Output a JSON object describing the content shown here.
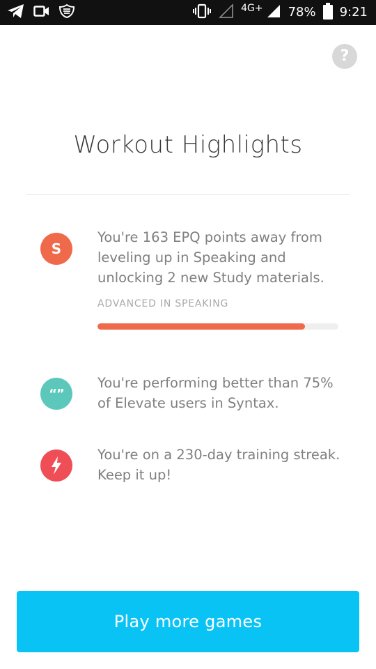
{
  "status_bar": {
    "network": "4G+",
    "battery": "78%",
    "time": "9:21",
    "icons": [
      "telegram-icon",
      "video-camera-icon",
      "app-shield-icon",
      "vibrate-icon",
      "signal-empty-icon",
      "signal-full-icon",
      "battery-icon"
    ]
  },
  "help": {
    "label": "?"
  },
  "title": "Workout Highlights",
  "highlights": [
    {
      "badge": "S",
      "icon": "speaking-badge-icon",
      "color": "#ef6a4a",
      "text": "You're 163 EPQ points away from leveling up in Speaking and unlocking 2 new Study materials.",
      "level_label": "ADVANCED IN SPEAKING",
      "progress": 0.86
    },
    {
      "badge": "“”",
      "icon": "quote-badge-icon",
      "color": "#5cc8bb",
      "text": "You're performing better than 75% of Elevate users in Syntax."
    },
    {
      "badge": "",
      "icon": "lightning-badge-icon",
      "color": "#ef4e57",
      "text": "You're on a 230-day training streak. Keep it up!"
    }
  ],
  "cta": {
    "label": "Play more games",
    "color": "#0ac3f5"
  }
}
